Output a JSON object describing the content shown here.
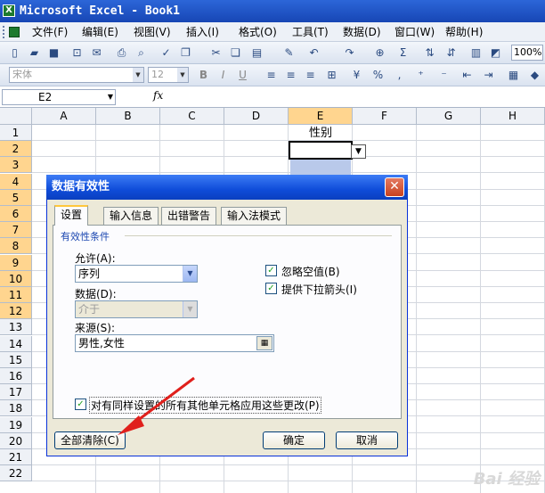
{
  "window": {
    "title": "Microsoft Excel - Book1"
  },
  "menu": [
    "文件(F)",
    "编辑(E)",
    "视图(V)",
    "插入(I)",
    "格式(O)",
    "工具(T)",
    "数据(D)",
    "窗口(W)",
    "帮助(H)"
  ],
  "format_toolbar": {
    "font": "宋体",
    "size": "12"
  },
  "standard_toolbar": {
    "zoom": "100%"
  },
  "formula_bar": {
    "name_box": "E2",
    "fx": "fx"
  },
  "grid": {
    "columns": [
      "A",
      "B",
      "C",
      "D",
      "E",
      "F",
      "G",
      "H"
    ],
    "rows": [
      "1",
      "2",
      "3",
      "4",
      "5",
      "6",
      "7",
      "8",
      "9",
      "10",
      "11",
      "12",
      "13",
      "14",
      "15",
      "16",
      "17",
      "18",
      "19",
      "20",
      "21",
      "22"
    ],
    "e1": "性别"
  },
  "dialog": {
    "title": "数据有效性",
    "tabs": [
      "设置",
      "输入信息",
      "出错警告",
      "输入法模式"
    ],
    "group_title": "有效性条件",
    "allow_label": "允许(A):",
    "allow_value": "序列",
    "data_label": "数据(D):",
    "data_value": "介于",
    "source_label": "来源(S):",
    "source_value": "男性,女性",
    "ignore_blank": "忽略空值(B)",
    "dropdown_arrow": "提供下拉箭头(I)",
    "apply_all": "对有同样设置的所有其他单元格应用这些更改(P)",
    "clear_all": "全部清除(C)",
    "ok": "确定",
    "cancel": "取消"
  },
  "colors": {
    "title_bar": "#1746b5",
    "highlight": "#ffd58f",
    "selected_cell": "#b9c9ea"
  }
}
